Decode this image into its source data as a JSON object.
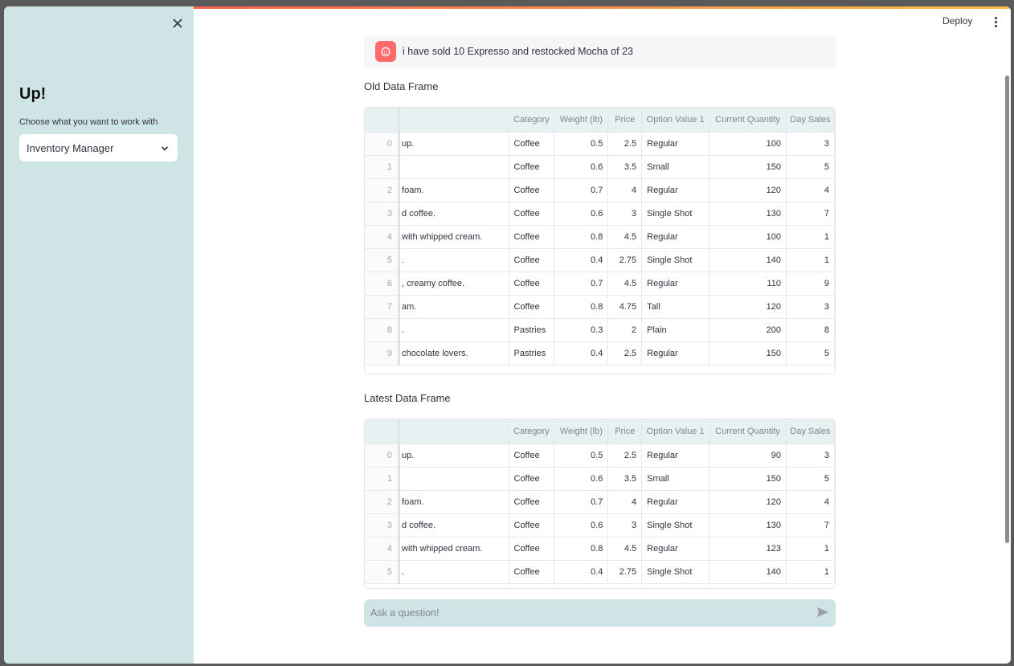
{
  "sidebar": {
    "title": "Up!",
    "select_label": "Choose what you want to work with",
    "select_value": "Inventory Manager"
  },
  "header": {
    "deploy_label": "Deploy"
  },
  "chat": {
    "message": "i have sold 10 Expresso and restocked Mocha of 23",
    "input_placeholder": "Ask a question!"
  },
  "old_frame": {
    "title": "Old Data Frame",
    "columns": [
      "",
      "",
      "Category",
      "Weight (lb)",
      "Price",
      "Option Value 1",
      "Current Quantity",
      "Day Sales"
    ],
    "rows": [
      [
        "0",
        "up.",
        "Coffee",
        "0.5",
        "2.5",
        "Regular",
        "100",
        "3"
      ],
      [
        "1",
        "",
        "Coffee",
        "0.6",
        "3.5",
        "Small",
        "150",
        "5"
      ],
      [
        "2",
        "foam.",
        "Coffee",
        "0.7",
        "4",
        "Regular",
        "120",
        "4"
      ],
      [
        "3",
        "d coffee.",
        "Coffee",
        "0.6",
        "3",
        "Single Shot",
        "130",
        "7"
      ],
      [
        "4",
        "with whipped cream.",
        "Coffee",
        "0.8",
        "4.5",
        "Regular",
        "100",
        "1"
      ],
      [
        "5",
        ".",
        "Coffee",
        "0.4",
        "2.75",
        "Single Shot",
        "140",
        "1"
      ],
      [
        "6",
        ", creamy coffee.",
        "Coffee",
        "0.7",
        "4.5",
        "Regular",
        "110",
        "9"
      ],
      [
        "7",
        "am.",
        "Coffee",
        "0.8",
        "4.75",
        "Tall",
        "120",
        "3"
      ],
      [
        "8",
        ".",
        "Pastries",
        "0.3",
        "2",
        "Plain",
        "200",
        "8"
      ],
      [
        "9",
        "chocolate lovers.",
        "Pastries",
        "0.4",
        "2.5",
        "Regular",
        "150",
        "5"
      ]
    ]
  },
  "latest_frame": {
    "title": "Latest Data Frame",
    "columns": [
      "",
      "",
      "Category",
      "Weight (lb)",
      "Price",
      "Option Value 1",
      "Current Quantity",
      "Day Sales"
    ],
    "rows": [
      [
        "0",
        "up.",
        "Coffee",
        "0.5",
        "2.5",
        "Regular",
        "90",
        "3"
      ],
      [
        "1",
        "",
        "Coffee",
        "0.6",
        "3.5",
        "Small",
        "150",
        "5"
      ],
      [
        "2",
        "foam.",
        "Coffee",
        "0.7",
        "4",
        "Regular",
        "120",
        "4"
      ],
      [
        "3",
        "d coffee.",
        "Coffee",
        "0.6",
        "3",
        "Single Shot",
        "130",
        "7"
      ],
      [
        "4",
        "with whipped cream.",
        "Coffee",
        "0.8",
        "4.5",
        "Regular",
        "123",
        "1"
      ],
      [
        "5",
        ".",
        "Coffee",
        "0.4",
        "2.75",
        "Single Shot",
        "140",
        "1"
      ]
    ]
  },
  "colors": {
    "sidebar_bg": "#cfe5e5",
    "accent": "#ff4b4b",
    "avatar": "#ff6b6b"
  }
}
